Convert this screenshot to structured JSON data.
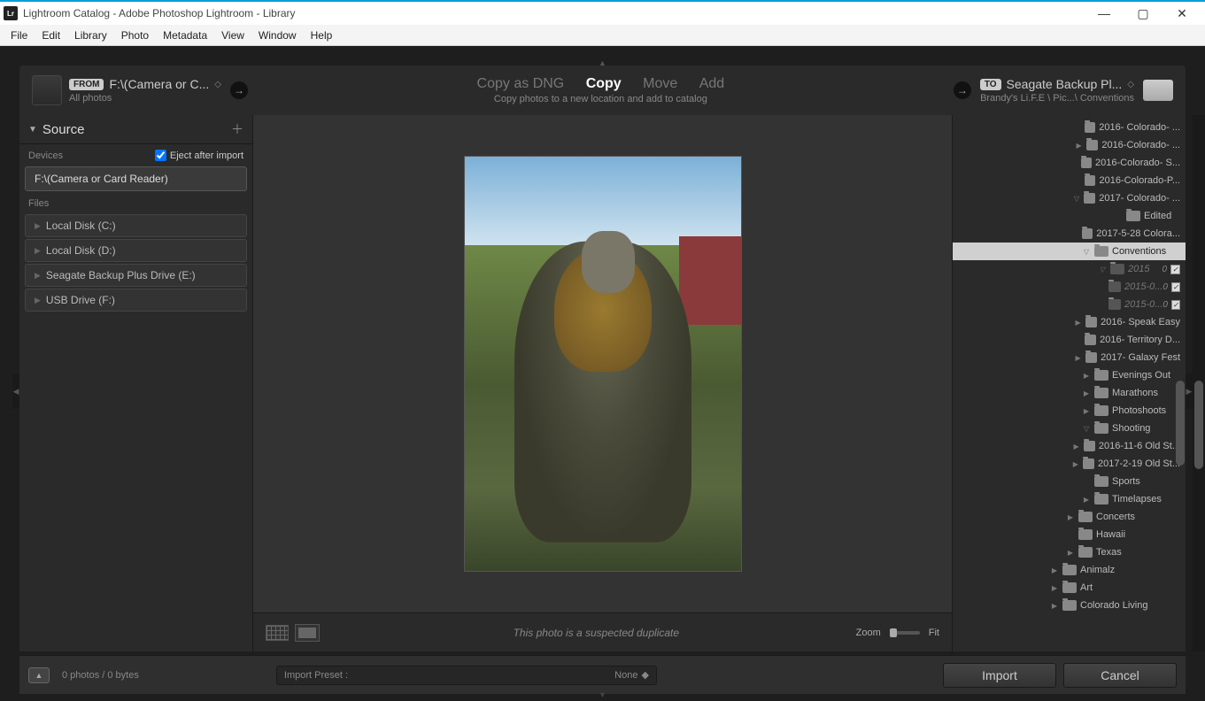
{
  "window": {
    "title": "Lightroom Catalog - Adobe Photoshop Lightroom - Library",
    "logo": "Lr"
  },
  "menu": [
    "File",
    "Edit",
    "Library",
    "Photo",
    "Metadata",
    "View",
    "Window",
    "Help"
  ],
  "header": {
    "from_label": "FROM",
    "from_path": "F:\\(Camera or C...",
    "from_sub": "All photos",
    "modes": {
      "copy_dng": "Copy as DNG",
      "copy": "Copy",
      "move": "Move",
      "add": "Add"
    },
    "sub": "Copy photos to a new location and add to catalog",
    "to_label": "TO",
    "to_path": "Seagate Backup Pl...",
    "to_sub": "Brandy's Li.F.E \\ Pic...\\ Conventions"
  },
  "source_panel": {
    "title": "Source",
    "devices_label": "Devices",
    "eject_label": "Eject after import",
    "device": "F:\\(Camera or Card Reader)",
    "files_label": "Files",
    "drives": [
      "Local Disk (C:)",
      "Local Disk (D:)",
      "Seagate Backup Plus Drive (E:)",
      "USB Drive (F:)"
    ]
  },
  "preview": {
    "message": "This photo is a suspected duplicate",
    "zoom_label": "Zoom",
    "fit_label": "Fit"
  },
  "dest_tree": [
    {
      "depth": 4,
      "chev": "",
      "label": "2016- Colorado- ..."
    },
    {
      "depth": 3,
      "chev": "▶",
      "label": "2016-Colorado- ..."
    },
    {
      "depth": 4,
      "chev": "",
      "label": "2016-Colorado- S..."
    },
    {
      "depth": 4,
      "chev": "",
      "label": "2016-Colorado-P..."
    },
    {
      "depth": 3,
      "chev": "▽",
      "label": "2017- Colorado- ..."
    },
    {
      "depth": 4,
      "chev": "",
      "label": "Edited"
    },
    {
      "depth": 4,
      "chev": "",
      "label": "2017-5-28 Colora..."
    },
    {
      "depth": 2,
      "chev": "▽",
      "label": "Conventions",
      "sel": true
    },
    {
      "depth": 3,
      "chev": "▽",
      "label": "2015",
      "dim": true,
      "count": "0",
      "chk": true
    },
    {
      "depth": 4,
      "chev": "",
      "label": "2015-0...",
      "dim": true,
      "count": "0",
      "chk": true
    },
    {
      "depth": 4,
      "chev": "",
      "label": "2015-0...",
      "dim": true,
      "count": "0",
      "chk": true
    },
    {
      "depth": 3,
      "chev": "▶",
      "label": "2016- Speak Easy"
    },
    {
      "depth": 3,
      "chev": "",
      "label": "2016- Territory D..."
    },
    {
      "depth": 3,
      "chev": "▶",
      "label": "2017- Galaxy Fest"
    },
    {
      "depth": 2,
      "chev": "▶",
      "label": "Evenings Out"
    },
    {
      "depth": 2,
      "chev": "▶",
      "label": "Marathons"
    },
    {
      "depth": 2,
      "chev": "▶",
      "label": "Photoshoots"
    },
    {
      "depth": 2,
      "chev": "▽",
      "label": "Shooting"
    },
    {
      "depth": 3,
      "chev": "▶",
      "label": "2016-11-6 Old St..."
    },
    {
      "depth": 3,
      "chev": "▶",
      "label": "2017-2-19 Old St..."
    },
    {
      "depth": 2,
      "chev": "",
      "label": "Sports"
    },
    {
      "depth": 2,
      "chev": "▶",
      "label": "Timelapses"
    },
    {
      "depth": 1,
      "chev": "▶",
      "label": "Concerts"
    },
    {
      "depth": 1,
      "chev": "",
      "label": "Hawaii"
    },
    {
      "depth": 1,
      "chev": "▶",
      "label": "Texas"
    },
    {
      "depth": 0,
      "chev": "▶",
      "label": "Animalz"
    },
    {
      "depth": 0,
      "chev": "▶",
      "label": "Art"
    },
    {
      "depth": 0,
      "chev": "▶",
      "label": "Colorado Living"
    }
  ],
  "footer": {
    "status": "0 photos / 0 bytes",
    "preset_label": "Import Preset :",
    "preset_value": "None",
    "import": "Import",
    "cancel": "Cancel"
  }
}
